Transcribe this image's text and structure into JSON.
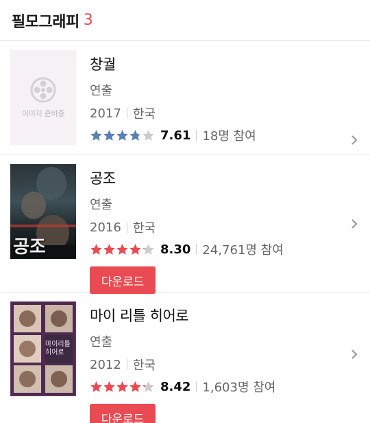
{
  "header": {
    "title": "필모그래피",
    "count": "3"
  },
  "placeholder_text": "이미지 준비중",
  "films": [
    {
      "title": "창궐",
      "role": "연출",
      "year": "2017",
      "country": "한국",
      "rating": 7.61,
      "score": "7.61",
      "participants": "18명 참여",
      "star_color": "#5b7fb5",
      "has_download": false
    },
    {
      "title": "공조",
      "role": "연출",
      "year": "2016",
      "country": "한국",
      "rating": 8.3,
      "score": "8.30",
      "participants": "24,761명 참여",
      "star_color": "#ea4b52",
      "poster_text": "공조",
      "has_download": true,
      "download_label": "다운로드"
    },
    {
      "title": "마이 리틀 히어로",
      "role": "연출",
      "year": "2012",
      "country": "한국",
      "rating": 8.42,
      "score": "8.42",
      "participants": "1,603명 참여",
      "star_color": "#ea4b52",
      "poster_text": "마이리틀히어로",
      "has_download": true,
      "download_label": "다운로드"
    }
  ],
  "colors": {
    "accent": "#ea4b52",
    "star_empty": "#cccccc"
  }
}
